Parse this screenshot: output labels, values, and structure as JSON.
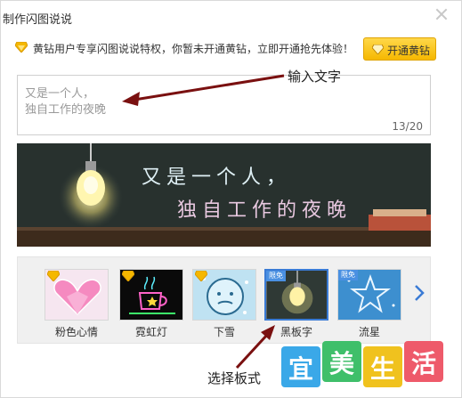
{
  "window": {
    "title": "制作闪图说说"
  },
  "notice": {
    "text": "黄钻用户专享闪图说说特权，你暂未开通黄钻，立即开通抢先体验！",
    "button_label": "开通黄钻"
  },
  "editor": {
    "line1": "又是一个人，",
    "line2": "独自工作的夜晚",
    "counter": "13/20"
  },
  "annotations": {
    "input_text": "输入文字",
    "choose_style": "选择板式"
  },
  "preview": {
    "line1": "又是一个人，",
    "line2": "独自工作的夜晚"
  },
  "styles": {
    "items": [
      {
        "label": "粉色心情",
        "badge": "vip",
        "selected": false
      },
      {
        "label": "霓虹灯",
        "badge": "vip",
        "selected": false
      },
      {
        "label": "下雪",
        "badge": "vip",
        "selected": false
      },
      {
        "label": "黑板字",
        "badge": "限免",
        "selected": true
      },
      {
        "label": "流星",
        "badge": "限免",
        "selected": false
      }
    ]
  },
  "watermark": {
    "chars": [
      "宜",
      "美",
      "生",
      "活"
    ]
  },
  "colors": {
    "accent": "#f5b800",
    "selection": "#3a7bd5",
    "annotation_arrow": "#7a1010"
  }
}
